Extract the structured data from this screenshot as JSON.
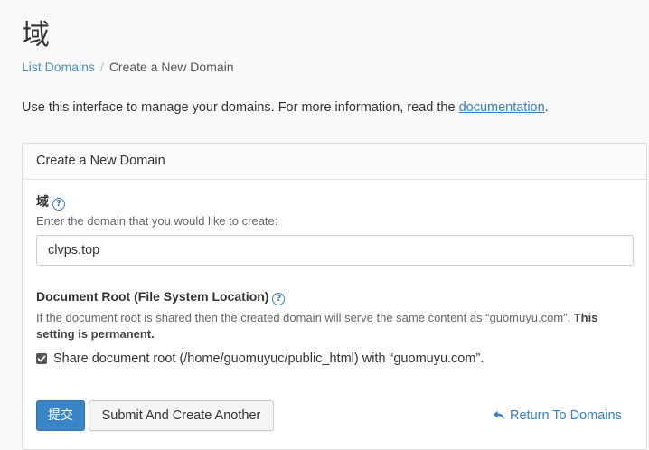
{
  "page": {
    "title": "域"
  },
  "breadcrumb": {
    "link_label": "List Domains",
    "separator": "/",
    "current": "Create a New Domain"
  },
  "intro": {
    "text": "Use this interface to manage your domains. For more information, read the ",
    "link_label": "documentation",
    "suffix": "."
  },
  "panel": {
    "heading": "Create a New Domain",
    "domain": {
      "label": "域",
      "help_icon": "?",
      "hint": "Enter the domain that you would like to create:",
      "value": "clvps.top"
    },
    "docroot": {
      "label": "Document Root (File System Location)",
      "help_icon": "?",
      "hint": "If the document root is shared then the created domain will serve the same content as “guomuyu.com”. ",
      "hint_bold": "This setting is permanent."
    },
    "share": {
      "checked": true,
      "label": "Share document root (/home/guomuyuc/public_html) with “guomuyu.com”."
    },
    "buttons": {
      "submit_label": "提交",
      "another_label": "Submit And Create Another",
      "return_label": "Return To Domains"
    }
  },
  "colors": {
    "accent": "#3a85c6",
    "link": "#3a7fbf"
  },
  "icons": {
    "help": "question-circle-icon",
    "checkbox": "check-icon",
    "return": "reply-arrow-icon"
  }
}
